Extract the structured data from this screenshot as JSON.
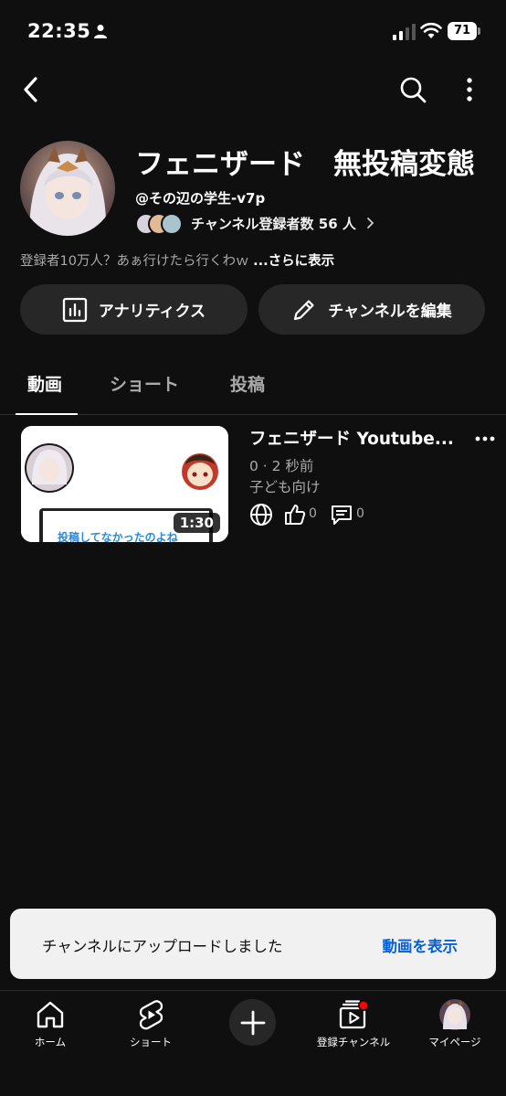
{
  "status_bar": {
    "time": "22:35",
    "battery": "71",
    "icons": [
      "person-icon",
      "signal-icon",
      "wifi-icon",
      "battery-icon"
    ]
  },
  "top_nav": {
    "icons": [
      "back-arrow-icon",
      "search-icon",
      "more-vertical-icon"
    ]
  },
  "channel": {
    "name": "フェニザード　無投稿変態",
    "handle": "@その辺の学生-v7p",
    "subscriber_text": "チャンネル登録者数 56 人",
    "description": "登録者10万人？あぁ行けたら行くわｗ ",
    "more_label": "...さらに表示"
  },
  "actions": {
    "analytics_label": "アナリティクス",
    "edit_label": "チャンネルを編集"
  },
  "tabs": [
    {
      "label": "動画",
      "active": true
    },
    {
      "label": "ショート",
      "active": false
    },
    {
      "label": "投稿",
      "active": false
    }
  ],
  "video": {
    "title": "フェニザード Youtube...",
    "meta": "0 · 2 秒前",
    "audience": "子ども向け",
    "duration": "1:30",
    "thumbnail_caption": "投稿してなかったのよね",
    "likes": "0",
    "comments": "0"
  },
  "snackbar": {
    "text": "チャンネルにアップロードしました",
    "action": "動画を表示"
  },
  "bottom_nav": {
    "items": [
      {
        "label": "ホーム",
        "icon": "home-icon"
      },
      {
        "label": "ショート",
        "icon": "shorts-icon"
      },
      {
        "label": "",
        "icon": "plus-icon"
      },
      {
        "label": "登録チャンネル",
        "icon": "subscriptions-icon"
      },
      {
        "label": "マイページ",
        "icon": "avatar"
      }
    ]
  },
  "colors": {
    "background": "#0f0f0f",
    "surface": "#272727",
    "accent_link": "#065fd4",
    "notification_dot": "#ff0000"
  }
}
